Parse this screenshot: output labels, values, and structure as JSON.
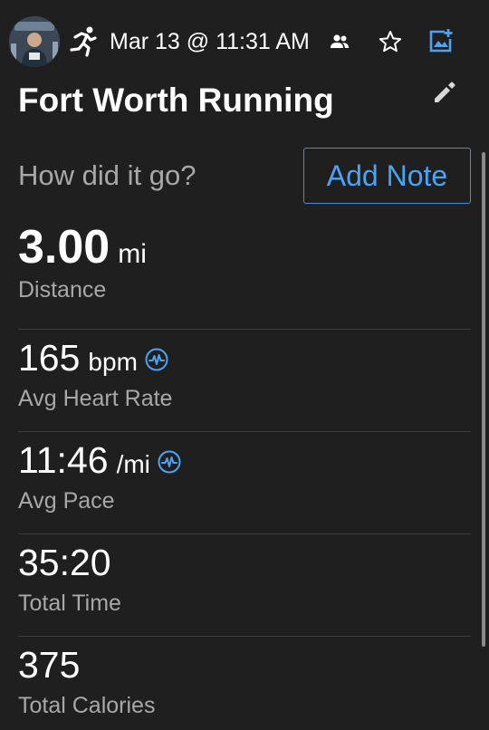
{
  "header": {
    "date_time": "Mar 13 @ 11:31 AM",
    "avatar_icon": "user-avatar",
    "activity_icon": "running-icon",
    "people_icon": "people-icon",
    "star_icon": "star-outline-icon",
    "add_photo_icon": "add-photo-icon"
  },
  "activity": {
    "title": "Fort Worth Running",
    "edit_icon": "pencil-icon"
  },
  "note": {
    "prompt": "How did it go?",
    "add_label": "Add Note"
  },
  "stats": [
    {
      "value": "3.00",
      "unit": "mi",
      "label": "Distance"
    },
    {
      "value": "165",
      "unit": "bpm",
      "label": "Avg Heart Rate",
      "icon": "heart-rate-icon"
    },
    {
      "value": "11:46",
      "unit": "/mi",
      "label": "Avg Pace",
      "icon": "heart-rate-icon"
    },
    {
      "value": "35:20",
      "unit": "",
      "label": "Total Time"
    },
    {
      "value": "375",
      "unit": "",
      "label": "Total Calories"
    }
  ],
  "colors": {
    "background": "#1f1f1f",
    "accent": "#4ba3f5",
    "secondary_text": "#a8a8a8",
    "divider": "#3d3d3d"
  }
}
